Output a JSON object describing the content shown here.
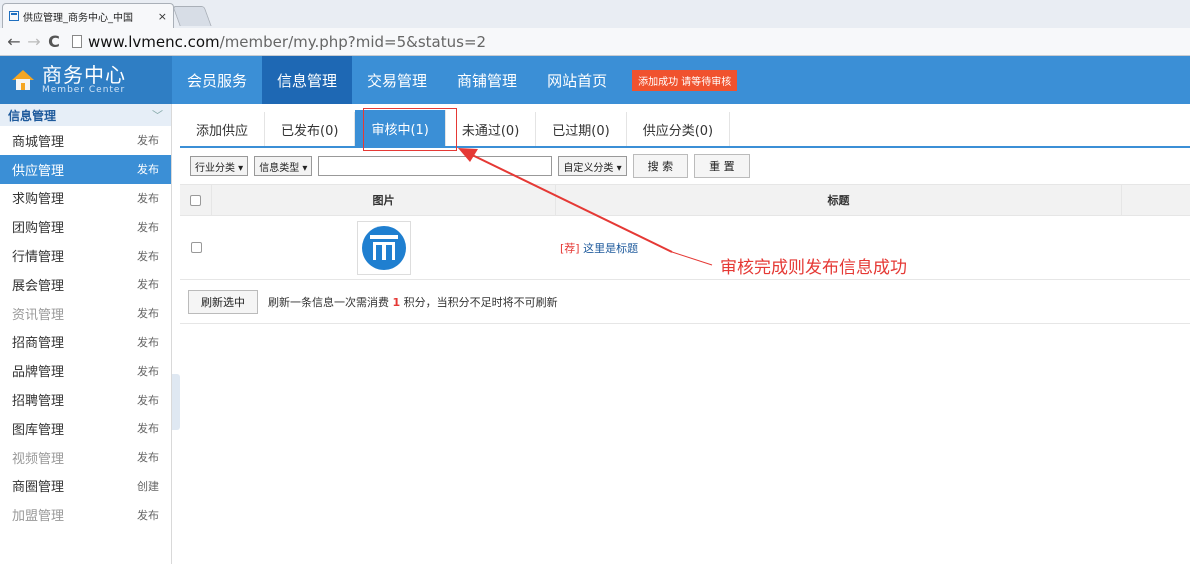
{
  "browser": {
    "tab_title": "供应管理_商务中心_中国",
    "tab_close": "×",
    "url_host": "www.lvmenc.com",
    "url_path": "/member/my.php?mid=5&status=2",
    "nav_back": "←",
    "nav_forward": "→",
    "nav_reload": "C"
  },
  "brand": {
    "cn": "商务中心",
    "en": "Member Center"
  },
  "mainnav": {
    "items": [
      "会员服务",
      "信息管理",
      "交易管理",
      "商铺管理",
      "网站首页"
    ],
    "active_index": 1,
    "notice": "添加成功 请等待审核"
  },
  "sidebar": {
    "heading": "信息管理",
    "chevron": "﹀",
    "items": [
      {
        "label": "商城管理",
        "action": "发布"
      },
      {
        "label": "供应管理",
        "action": "发布"
      },
      {
        "label": "求购管理",
        "action": "发布"
      },
      {
        "label": "团购管理",
        "action": "发布"
      },
      {
        "label": "行情管理",
        "action": "发布"
      },
      {
        "label": "展会管理",
        "action": "发布"
      },
      {
        "label": "资讯管理",
        "action": "发布"
      },
      {
        "label": "招商管理",
        "action": "发布"
      },
      {
        "label": "品牌管理",
        "action": "发布"
      },
      {
        "label": "招聘管理",
        "action": "发布"
      },
      {
        "label": "图库管理",
        "action": "发布"
      },
      {
        "label": "视频管理",
        "action": "发布"
      },
      {
        "label": "商圈管理",
        "action": "创建"
      },
      {
        "label": "加盟管理",
        "action": "发布"
      }
    ],
    "active_index": 1
  },
  "subtabs": {
    "items": [
      "添加供应",
      "已发布(0)",
      "审核中(1)",
      "未通过(0)",
      "已过期(0)",
      "供应分类(0)"
    ],
    "active_index": 2
  },
  "search": {
    "industry": "行业分类 ▾",
    "info_type": "信息类型 ▾",
    "custom": "自定义分类 ▾",
    "search_btn": "搜 索",
    "reset_btn": "重 置"
  },
  "table": {
    "col_image": "图片",
    "col_title": "标题",
    "row": {
      "tag": "[荐]",
      "title": "这里是标题"
    }
  },
  "footer": {
    "refresh_btn": "刷新选中",
    "note_pre": "刷新一条信息一次需消费",
    "note_num": "1",
    "note_post": "积分，当积分不足时将不可刷新"
  },
  "annotation": {
    "text": "审核完成则发布信息成功",
    "color": "#e53935"
  }
}
